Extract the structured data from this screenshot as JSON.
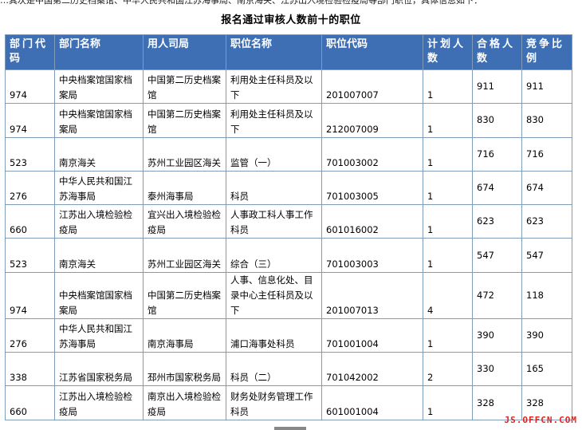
{
  "intro_text": "…其次是中国第二历史档案馆、中华人民共和国江苏海事局、南京海关、江苏出入境检验检疫局等部门职位，具体信息如下：",
  "title": "报名通过审核人数前十的职位",
  "headers": [
    "部门代码",
    "部门名称",
    "用人司局",
    "职位名称",
    "职位代码",
    "计划人数",
    "合格人数",
    "竞争比例"
  ],
  "rows": [
    {
      "dept_code": "974",
      "dept_name": "中央档案馆国家档案局",
      "bureau": "中国第二历史档案馆",
      "position": "利用处主任科员及以下",
      "pos_code": "201007007",
      "plan": "1",
      "qualified": "911",
      "ratio": "911"
    },
    {
      "dept_code": "974",
      "dept_name": "中央档案馆国家档案局",
      "bureau": "中国第二历史档案馆",
      "position": "利用处主任科员及以下",
      "pos_code": "212007009",
      "plan": "1",
      "qualified": "830",
      "ratio": "830"
    },
    {
      "dept_code": "523",
      "dept_name": "南京海关",
      "bureau": "苏州工业园区海关",
      "position": "监管（一）",
      "pos_code": "701003002",
      "plan": "1",
      "qualified": "716",
      "ratio": "716"
    },
    {
      "dept_code": "276",
      "dept_name": "中华人民共和国江苏海事局",
      "bureau": "泰州海事局",
      "position": "科员",
      "pos_code": "701003005",
      "plan": "1",
      "qualified": "674",
      "ratio": "674"
    },
    {
      "dept_code": "660",
      "dept_name": "江苏出入境检验检疫局",
      "bureau": "宜兴出入境检验检疫局",
      "position": "人事政工科人事工作科员",
      "pos_code": "601016002",
      "plan": "1",
      "qualified": "623",
      "ratio": "623"
    },
    {
      "dept_code": "523",
      "dept_name": "南京海关",
      "bureau": "苏州工业园区海关",
      "position": "综合（三）",
      "pos_code": "701003003",
      "plan": "1",
      "qualified": "547",
      "ratio": "547"
    },
    {
      "dept_code": "974",
      "dept_name": "中央档案馆国家档案局",
      "bureau": "中国第二历史档案馆",
      "position": "人事、信息化处、目录中心主任科员及以下",
      "pos_code": "201007013",
      "plan": "4",
      "qualified": "472",
      "ratio": "118"
    },
    {
      "dept_code": "276",
      "dept_name": "中华人民共和国江苏海事局",
      "bureau": "南京海事局",
      "position": "浦口海事处科员",
      "pos_code": "701001004",
      "plan": "1",
      "qualified": "390",
      "ratio": "390"
    },
    {
      "dept_code": "338",
      "dept_name": "江苏省国家税务局",
      "bureau": "邳州市国家税务局",
      "position": "科员（二）",
      "pos_code": "701042002",
      "plan": "2",
      "qualified": "330",
      "ratio": "165"
    },
    {
      "dept_code": "660",
      "dept_name": "江苏出入境检验检疫局",
      "bureau": "南京出入境检验检疫局",
      "position": "财务处财务管理工作科员",
      "pos_code": "601001004",
      "plan": "1",
      "qualified": "328",
      "ratio": "328"
    }
  ],
  "watermark": "JS.OFFCN.COM",
  "colors": {
    "header_bg": "#3e6fb4",
    "header_text": "#ffffff",
    "border": "#7f9db9",
    "watermark": "#e2231a"
  }
}
